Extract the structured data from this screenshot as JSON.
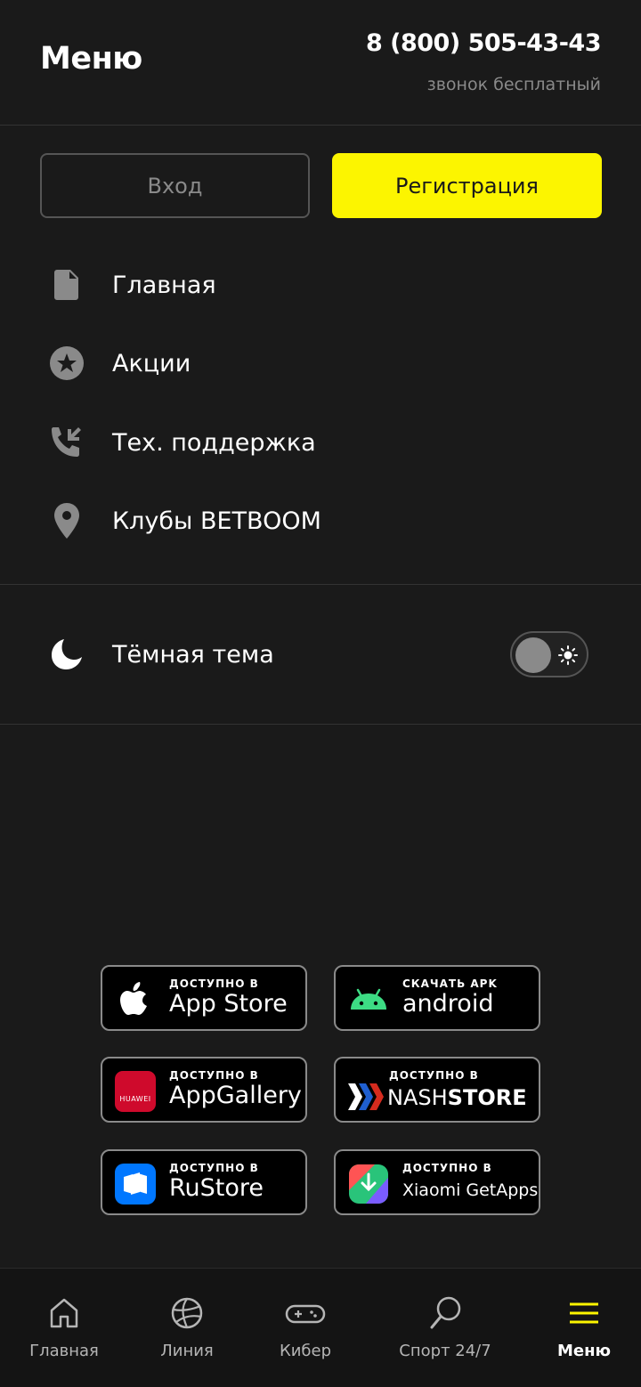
{
  "header": {
    "title": "Меню",
    "phone": "8 (800) 505-43-43",
    "phone_note": "звонок бесплатный"
  },
  "auth": {
    "login_label": "Вход",
    "register_label": "Регистрация"
  },
  "menu": {
    "items": [
      {
        "label": "Главная",
        "icon": "document-icon"
      },
      {
        "label": "Акции",
        "icon": "star-circle-icon"
      },
      {
        "label": "Тех. поддержка",
        "icon": "phone-callback-icon"
      },
      {
        "label": "Клубы BETBOOM",
        "icon": "location-pin-icon"
      }
    ]
  },
  "theme": {
    "label": "Тёмная тема",
    "enabled": false
  },
  "stores": [
    {
      "small": "ДОСТУПНО В",
      "big": "App Store",
      "icon": "apple-icon"
    },
    {
      "small": "СКАЧАТЬ APK",
      "big": "android",
      "icon": "android-icon"
    },
    {
      "small": "ДОСТУПНО В",
      "big": "AppGallery",
      "icon": "huawei-icon"
    },
    {
      "small": "ДОСТУПНО В",
      "big_a": "NASH",
      "big_b": "STORE",
      "icon": "nashstore-icon"
    },
    {
      "small": "ДОСТУПНО В",
      "big": "RuStore",
      "icon": "rustore-icon"
    },
    {
      "small": "ДОСТУПНО В",
      "big": "Xiaomi GetApps",
      "icon": "getapps-icon"
    }
  ],
  "huawei_logo_text": "HUAWEI",
  "bottom_nav": [
    {
      "label": "Главная",
      "icon": "home-icon"
    },
    {
      "label": "Линия",
      "icon": "ball-icon"
    },
    {
      "label": "Кибер",
      "icon": "gamepad-icon"
    },
    {
      "label": "Спорт 24/7",
      "icon": "ping-pong-icon"
    },
    {
      "label": "Меню",
      "icon": "hamburger-icon",
      "active": true
    }
  ],
  "colors": {
    "accent": "#fcf500",
    "background": "#1a1a1a",
    "muted": "#8a8a8a"
  }
}
